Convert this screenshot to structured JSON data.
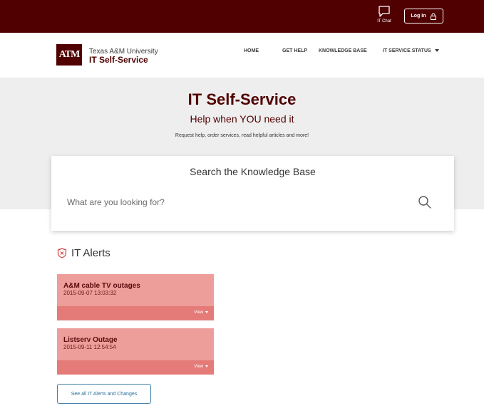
{
  "topbar": {
    "chat_label": "IT Chat",
    "login_label": "Log In"
  },
  "brand": {
    "logo_text": "ATM",
    "university": "Texas A&M University",
    "site_name": "IT Self-Service"
  },
  "nav": {
    "items": [
      {
        "label": "HOME"
      },
      {
        "label": "GET HELP"
      },
      {
        "label": "KNOWLEDGE BASE"
      },
      {
        "label": "IT SERVICE STATUS"
      }
    ]
  },
  "hero": {
    "title": "IT Self-Service",
    "subtitle": "Help when YOU need it",
    "description": "Request help, order services, read helpful articles and more!"
  },
  "search": {
    "title": "Search the Knowledge Base",
    "placeholder": "What are you looking for?",
    "icon": "search-icon"
  },
  "alerts": {
    "heading": "IT Alerts",
    "items": [
      {
        "title": "A&M cable TV outages",
        "date": "2015-09-07 13:03:32",
        "view_label": "View"
      },
      {
        "title": "Listserv Outage",
        "date": "2015-09-11 12:54:54",
        "view_label": "View"
      }
    ],
    "see_all_label": "See all IT Alerts and Changes"
  },
  "colors": {
    "maroon": "#500000",
    "alert_bg": "#ed9e9b",
    "alert_bar": "#e47b78",
    "link_blue": "#2a6f9a"
  }
}
